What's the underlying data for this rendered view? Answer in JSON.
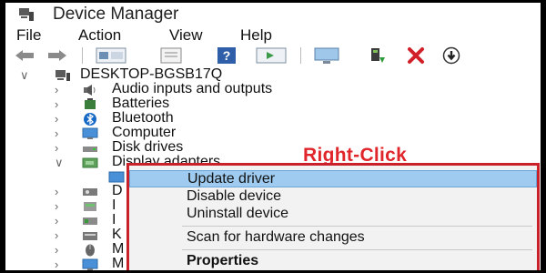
{
  "window": {
    "title": "Device Manager"
  },
  "menu": [
    "File",
    "Action",
    "View",
    "Help"
  ],
  "toolbar": [
    "back-arrow-icon",
    "forward-arrow-icon",
    "show-hide-tree-icon",
    "properties-icon",
    "help-icon",
    "run-icon",
    "monitor-icon",
    "update-driver-icon",
    "uninstall-icon",
    "download-icon"
  ],
  "tree": {
    "root": "DESKTOP-BGSB17Q",
    "items": [
      {
        "label": "Audio inputs and outputs",
        "icon": "speaker-icon",
        "expanded": false
      },
      {
        "label": "Batteries",
        "icon": "battery-icon",
        "expanded": false
      },
      {
        "label": "Bluetooth",
        "icon": "bluetooth-icon",
        "expanded": false
      },
      {
        "label": "Computer",
        "icon": "computer-icon",
        "expanded": false
      },
      {
        "label": "Disk drives",
        "icon": "disk-icon",
        "expanded": false
      },
      {
        "label": "Display adapters",
        "icon": "display-adapter-icon",
        "expanded": true
      },
      {
        "label": "D",
        "icon": "dvd-icon",
        "expanded": false
      },
      {
        "label": "I",
        "icon": "hid-icon",
        "expanded": false
      },
      {
        "label": "I",
        "icon": "ide-icon",
        "expanded": false
      },
      {
        "label": "K",
        "icon": "keyboard-icon",
        "expanded": false
      },
      {
        "label": "M",
        "icon": "mouse-icon",
        "expanded": false
      },
      {
        "label": "M",
        "icon": "monitor-icon",
        "expanded": false
      }
    ]
  },
  "annotation": "Right-Click",
  "context_menu": {
    "items": [
      {
        "label": "Update driver",
        "highlighted": true
      },
      {
        "label": "Disable device"
      },
      {
        "label": "Uninstall device"
      },
      {
        "label": "Scan for hardware changes"
      },
      {
        "label": "Properties",
        "bold": true
      }
    ]
  },
  "colors": {
    "annotation": "#e0262b",
    "highlight": "#9ecbef",
    "border": "#c9202a"
  }
}
